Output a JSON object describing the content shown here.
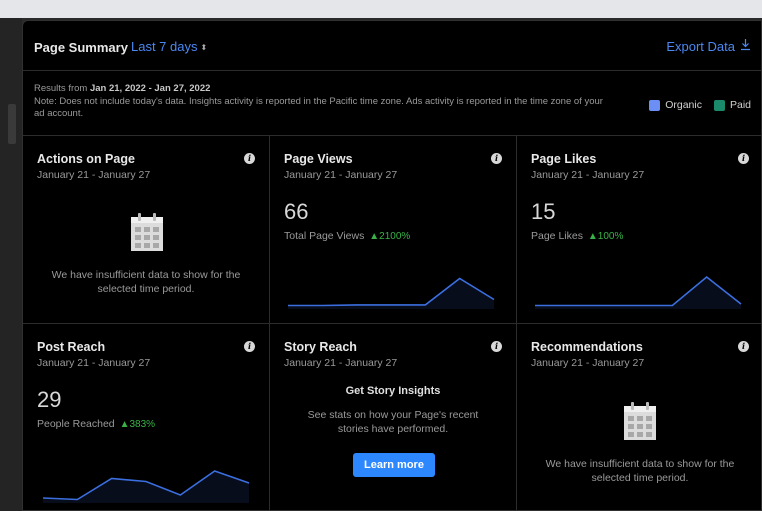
{
  "header": {
    "title": "Page Summary",
    "range_label": "Last 7 days",
    "range_caret": "⬍",
    "export_label": "Export Data",
    "export_icon": "download-icon"
  },
  "note": {
    "results_prefix": "Results from ",
    "results_range": "Jan 21, 2022 - Jan 27, 2022",
    "text": "Note: Does not include today's data. Insights activity is reported in the Pacific time zone. Ads activity is reported in the time zone of your ad account."
  },
  "legend": {
    "organic_label": "Organic",
    "organic_color": "#6b8ff5",
    "paid_label": "Paid",
    "paid_color": "#1b8a6b"
  },
  "cards": {
    "actions": {
      "title": "Actions on Page",
      "dates": "January 21 - January 27",
      "empty": "We have insufficient data to show for the selected time period."
    },
    "views": {
      "title": "Page Views",
      "dates": "January 21 - January 27",
      "value": "66",
      "sub": "Total Page Views",
      "change": "▲2100%",
      "trend": [
        0.05,
        0.05,
        0.07,
        0.07,
        0.07,
        0.95,
        0.25
      ]
    },
    "likes": {
      "title": "Page Likes",
      "dates": "January 21 - January 27",
      "value": "15",
      "sub": "Page Likes",
      "change": "▲100%",
      "trend": [
        0.05,
        0.05,
        0.05,
        0.05,
        0.05,
        1.0,
        0.1
      ]
    },
    "reach": {
      "title": "Post Reach",
      "dates": "January 21 - January 27",
      "value": "29",
      "sub": "People Reached",
      "change": "▲383%",
      "trend": [
        0.1,
        0.05,
        0.75,
        0.65,
        0.2,
        1.0,
        0.6
      ]
    },
    "story": {
      "title": "Story Reach",
      "dates": "January 21 - January 27",
      "heading": "Get Story Insights",
      "body": "See stats on how your Page's recent stories have performed.",
      "button": "Learn more"
    },
    "recs": {
      "title": "Recommendations",
      "dates": "January 21 - January 27",
      "empty": "We have insufficient data to show for the selected time period."
    }
  },
  "colors": {
    "accent": "#4b88f2",
    "line": "#3b6fe0",
    "positive": "#38b247"
  }
}
